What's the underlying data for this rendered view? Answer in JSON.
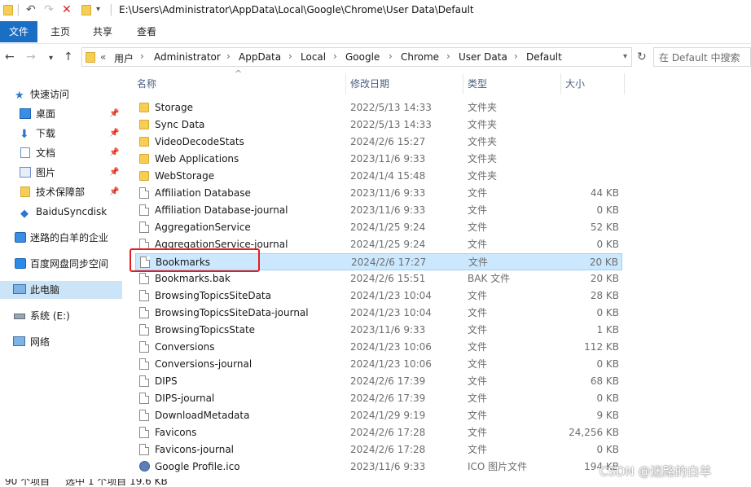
{
  "titlebar": {
    "path": "E:\\Users\\Administrator\\AppData\\Local\\Google\\Chrome\\User Data\\Default"
  },
  "ribbon": {
    "tabs": [
      "文件",
      "主页",
      "共享",
      "查看"
    ]
  },
  "address": {
    "prefix": "«",
    "segments": [
      "用户",
      "Administrator",
      "AppData",
      "Local",
      "Google",
      "Chrome",
      "User Data",
      "Default"
    ],
    "search_placeholder": "在 Default 中搜索"
  },
  "sidebar": {
    "items": [
      {
        "label": "快速访问",
        "icon": "star-icon"
      },
      {
        "label": "桌面",
        "icon": "desktop-icon",
        "pinned": true
      },
      {
        "label": "下载",
        "icon": "download-icon",
        "pinned": true
      },
      {
        "label": "文档",
        "icon": "document-icon",
        "pinned": true
      },
      {
        "label": "图片",
        "icon": "picture-icon",
        "pinned": true
      },
      {
        "label": "技术保障部",
        "icon": "folder-icon",
        "pinned": true
      },
      {
        "label": "BaiduSyncdisk",
        "icon": "baidu-sync-icon"
      },
      {
        "label": "迷路的白羊的企业",
        "icon": "enterprise-icon"
      },
      {
        "label": "百度网盘同步空间",
        "icon": "baidu-netdisk-icon"
      },
      {
        "label": "此电脑",
        "icon": "computer-icon",
        "selected": true
      },
      {
        "label": "系统 (E:)",
        "icon": "drive-icon"
      },
      {
        "label": "网络",
        "icon": "network-icon"
      }
    ]
  },
  "columns": {
    "name": "名称",
    "date": "修改日期",
    "type": "类型",
    "size": "大小"
  },
  "files": [
    {
      "name": "Storage",
      "date": "2022/5/13 14:33",
      "type": "文件夹",
      "size": "",
      "kind": "folder"
    },
    {
      "name": "Sync Data",
      "date": "2022/5/13 14:33",
      "type": "文件夹",
      "size": "",
      "kind": "folder"
    },
    {
      "name": "VideoDecodeStats",
      "date": "2024/2/6 15:27",
      "type": "文件夹",
      "size": "",
      "kind": "folder"
    },
    {
      "name": "Web Applications",
      "date": "2023/11/6 9:33",
      "type": "文件夹",
      "size": "",
      "kind": "folder"
    },
    {
      "name": "WebStorage",
      "date": "2024/1/4 15:48",
      "type": "文件夹",
      "size": "",
      "kind": "folder"
    },
    {
      "name": "Affiliation Database",
      "date": "2023/11/6 9:33",
      "type": "文件",
      "size": "44 KB",
      "kind": "doc"
    },
    {
      "name": "Affiliation Database-journal",
      "date": "2023/11/6 9:33",
      "type": "文件",
      "size": "0 KB",
      "kind": "doc"
    },
    {
      "name": "AggregationService",
      "date": "2024/1/25 9:24",
      "type": "文件",
      "size": "52 KB",
      "kind": "doc"
    },
    {
      "name": "AggregationService-journal",
      "date": "2024/1/25 9:24",
      "type": "文件",
      "size": "0 KB",
      "kind": "doc"
    },
    {
      "name": "Bookmarks",
      "date": "2024/2/6 17:27",
      "type": "文件",
      "size": "20 KB",
      "kind": "doc",
      "selected": true
    },
    {
      "name": "Bookmarks.bak",
      "date": "2024/2/6 15:51",
      "type": "BAK 文件",
      "size": "20 KB",
      "kind": "doc"
    },
    {
      "name": "BrowsingTopicsSiteData",
      "date": "2024/1/23 10:04",
      "type": "文件",
      "size": "28 KB",
      "kind": "doc"
    },
    {
      "name": "BrowsingTopicsSiteData-journal",
      "date": "2024/1/23 10:04",
      "type": "文件",
      "size": "0 KB",
      "kind": "doc"
    },
    {
      "name": "BrowsingTopicsState",
      "date": "2023/11/6 9:33",
      "type": "文件",
      "size": "1 KB",
      "kind": "doc"
    },
    {
      "name": "Conversions",
      "date": "2024/1/23 10:06",
      "type": "文件",
      "size": "112 KB",
      "kind": "doc"
    },
    {
      "name": "Conversions-journal",
      "date": "2024/1/23 10:06",
      "type": "文件",
      "size": "0 KB",
      "kind": "doc"
    },
    {
      "name": "DIPS",
      "date": "2024/2/6 17:39",
      "type": "文件",
      "size": "68 KB",
      "kind": "doc"
    },
    {
      "name": "DIPS-journal",
      "date": "2024/2/6 17:39",
      "type": "文件",
      "size": "0 KB",
      "kind": "doc"
    },
    {
      "name": "DownloadMetadata",
      "date": "2024/1/29 9:19",
      "type": "文件",
      "size": "9 KB",
      "kind": "doc"
    },
    {
      "name": "Favicons",
      "date": "2024/2/6 17:28",
      "type": "文件",
      "size": "24,256 KB",
      "kind": "doc"
    },
    {
      "name": "Favicons-journal",
      "date": "2024/2/6 17:28",
      "type": "文件",
      "size": "0 KB",
      "kind": "doc"
    },
    {
      "name": "Google Profile.ico",
      "date": "2023/11/6 9:33",
      "type": "ICO 图片文件",
      "size": "194 KB",
      "kind": "ico"
    }
  ],
  "status": {
    "count": "90 个项目",
    "selection": "选中 1 个项目  19.6 KB"
  },
  "watermark": "CSDN @迷路的白羊"
}
